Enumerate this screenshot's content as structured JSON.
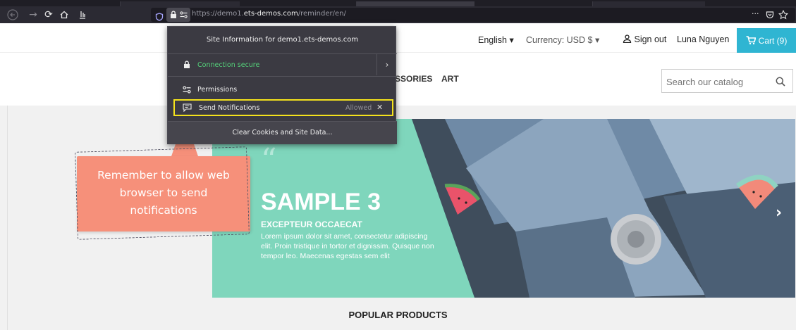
{
  "browser": {
    "url_prefix": "https://demo1.",
    "url_domain": "ets-demos.com",
    "url_path": "/reminder/en/",
    "overflow_icon": "···"
  },
  "popup": {
    "title": "Site Information for demo1.ets-demos.com",
    "connection": "Connection secure",
    "permissions_label": "Permissions",
    "notification_label": "Send Notifications",
    "notification_state": "Allowed",
    "clear_button": "Clear Cookies and Site Data..."
  },
  "header": {
    "language": "English",
    "currency": "Currency: USD $",
    "signout": "Sign out",
    "user": "Luna Nguyen",
    "cart": "Cart (9)"
  },
  "menu": {
    "accessories": "SSORIES",
    "art": "ART"
  },
  "search": {
    "placeholder": "Search our catalog"
  },
  "callout": {
    "line1": "Remember to allow web",
    "line2": "browser to send",
    "line3": "notifications"
  },
  "slide": {
    "quote": "“",
    "title": "SAMPLE 3",
    "subtitle": "EXCEPTEUR OCCAECAT",
    "description": "Lorem ipsum dolor sit amet, consectetur adipiscing elit. Proin tristique in tortor et dignissim. Quisque non tempor leo. Maecenas egestas sem elit"
  },
  "section": {
    "popular": "POPULAR PRODUCTS"
  },
  "colors": {
    "accent": "#2fb5d2",
    "slide_bg": "#7fd6bc",
    "callout": "#f6907a",
    "highlight": "#f4e21c"
  }
}
